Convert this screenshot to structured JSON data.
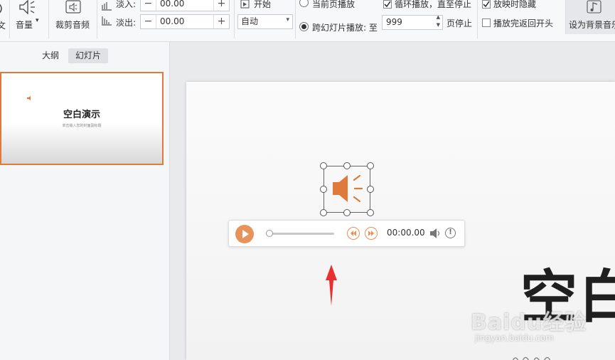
{
  "ribbon": {
    "volume_label": "音量",
    "trim_label": "裁剪音频",
    "fade_in_label": "淡入:",
    "fade_in_value": "00.00",
    "fade_out_label": "淡出:",
    "fade_out_value": "00.00",
    "start_label": "开始",
    "start_select_value": "自动",
    "current_page_label": "当前页播放",
    "cross_slides_label": "跨幻灯片播放: 至",
    "cross_slides_value": "999",
    "page_stop_label": "页停止",
    "loop_label": "循环播放，直至停止",
    "hide_label": "放映时隐藏",
    "rewind_label": "播放完返回开头",
    "bg_music_label": "设为背景音乐",
    "loop_checked": true,
    "hide_checked": true,
    "rewind_checked": false,
    "cross_slides_selected": true
  },
  "panel": {
    "tabs": [
      {
        "label": "大纲",
        "active": false
      },
      {
        "label": "幻灯片",
        "active": true
      }
    ],
    "thumbnail": {
      "title": "空白演示",
      "subtitle": "单击输入您的封面副标题"
    }
  },
  "player": {
    "time": "00:00.00",
    "progress": 0
  },
  "slide": {
    "title_fragment": "空白"
  },
  "watermark": {
    "brand": "Baidu经验",
    "url": "jingyan.baidu.com"
  },
  "colors": {
    "accent": "#e07a3b",
    "player_orange": "#e8935a",
    "arrow_red": "#e8302f",
    "selection_border": "#e07a3b"
  }
}
